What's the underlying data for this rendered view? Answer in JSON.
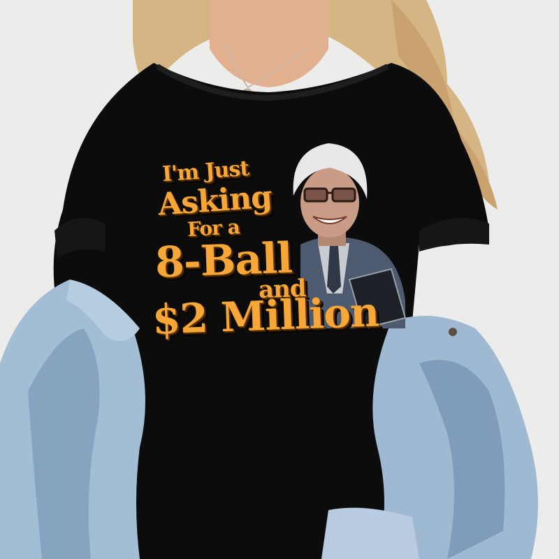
{
  "print": {
    "line1": "I'm Just",
    "line2": "Asking",
    "line3": "For a",
    "line4": "8-Ball",
    "line5": "and",
    "line6": "$2 Million"
  },
  "colors": {
    "background": "#ececea",
    "shirt": "#0b0b0b",
    "text_fill": "#f7a737",
    "text_shadow": "#1a0d00",
    "denim": "#9fbad3",
    "hair": "#d8b98a",
    "skin": "#e2b08f"
  }
}
